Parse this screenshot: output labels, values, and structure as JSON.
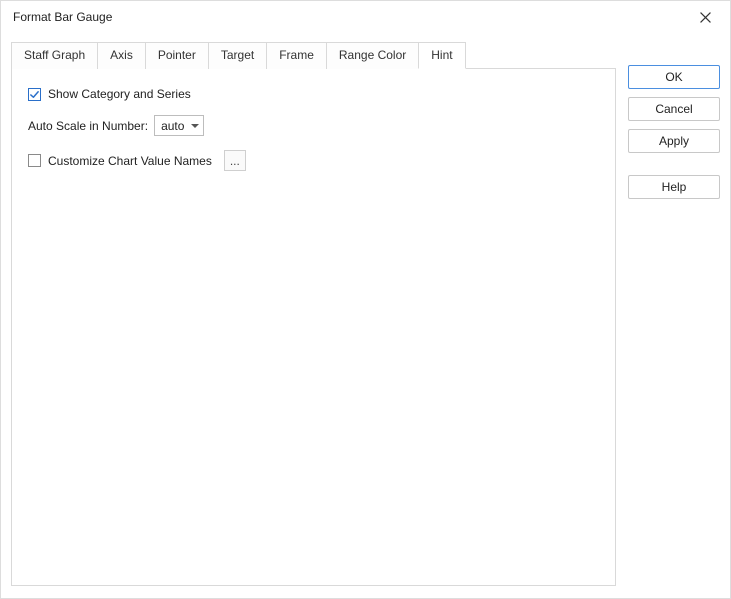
{
  "title": "Format Bar Gauge",
  "tabs": {
    "staff_graph": "Staff Graph",
    "axis": "Axis",
    "pointer": "Pointer",
    "target": "Target",
    "frame": "Frame",
    "range_color": "Range Color",
    "hint": "Hint"
  },
  "hint_panel": {
    "show_category_label": "Show Category and Series",
    "show_category_checked": true,
    "auto_scale_label": "Auto Scale in Number:",
    "auto_scale_value": "auto",
    "customize_label": "Customize Chart Value Names",
    "customize_checked": false,
    "ellipsis": "..."
  },
  "buttons": {
    "ok": "OK",
    "cancel": "Cancel",
    "apply": "Apply",
    "help": "Help"
  }
}
